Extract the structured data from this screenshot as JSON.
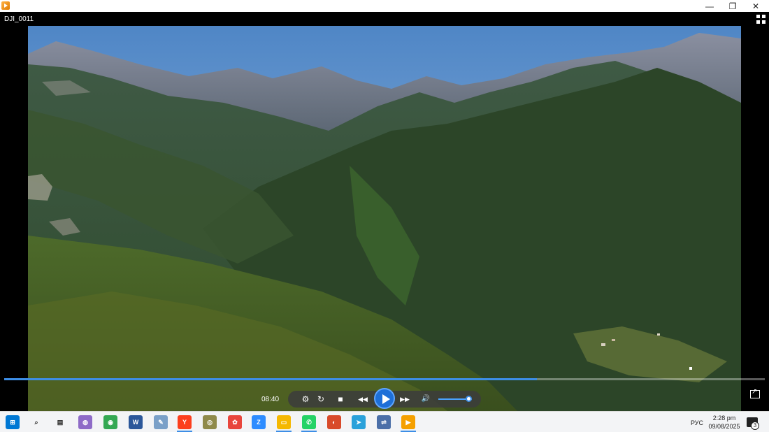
{
  "window": {
    "minimize_icon": "minimize-icon",
    "maximize_icon": "restore-icon",
    "close_icon": "close-icon",
    "minimize_glyph": "—",
    "maximize_glyph": "❐",
    "close_glyph": "✕"
  },
  "player": {
    "file_title": "DJI_0011",
    "current_time": "08:40",
    "progress": 0.7,
    "volume": 0.9,
    "accent_color": "#3d8ee6",
    "controls": {
      "settings_icon": "equalizer-icon",
      "repeat_icon": "repeat-icon",
      "stop_icon": "stop-icon",
      "rewind_icon": "rewind-icon",
      "play_icon": "play-icon",
      "forward_icon": "fast-forward-icon",
      "volume_icon": "volume-icon",
      "settings_glyph": "⚙",
      "repeat_glyph": "↻",
      "stop_glyph": "■",
      "rewind_glyph": "◀◀",
      "forward_glyph": "▶▶",
      "volume_glyph": "🔊"
    }
  },
  "taskbar": {
    "apps": [
      {
        "name": "start-icon",
        "color": "#0078d4",
        "glyph": "⊞"
      },
      {
        "name": "search-icon",
        "color": "#f3f4f6",
        "glyph": "⌕"
      },
      {
        "name": "widgets-icon",
        "color": "#f3f4f6",
        "glyph": "▤"
      },
      {
        "name": "browser-icon",
        "color": "#8e6bc7",
        "glyph": "◍"
      },
      {
        "name": "chrome-icon",
        "color": "#34a853",
        "glyph": "◉"
      },
      {
        "name": "word-icon",
        "color": "#2b579a",
        "glyph": "W"
      },
      {
        "name": "tool-icon",
        "color": "#7aa0c8",
        "glyph": "✎"
      },
      {
        "name": "yandex-icon",
        "color": "#fc3f1d",
        "glyph": "Y"
      },
      {
        "name": "eye-icon",
        "color": "#8f8a4a",
        "glyph": "◎"
      },
      {
        "name": "photos-icon",
        "color": "#e8453c",
        "glyph": "✿"
      },
      {
        "name": "zoom-icon",
        "color": "#2d8cff",
        "glyph": "Z"
      },
      {
        "name": "file-explorer-icon",
        "color": "#f5b800",
        "glyph": "▭"
      },
      {
        "name": "whatsapp-icon",
        "color": "#25d366",
        "glyph": "✆"
      },
      {
        "name": "app-icon",
        "color": "#d84a2a",
        "glyph": "◐"
      },
      {
        "name": "telegram-icon",
        "color": "#2aa1da",
        "glyph": "➤"
      },
      {
        "name": "transfer-icon",
        "color": "#4b6fa8",
        "glyph": "⇌"
      },
      {
        "name": "player-icon",
        "color": "#f5a000",
        "glyph": "▶"
      }
    ],
    "language": "РУС",
    "time": "2:28 pm",
    "date": "09/08/2025",
    "notification_count": "3"
  }
}
